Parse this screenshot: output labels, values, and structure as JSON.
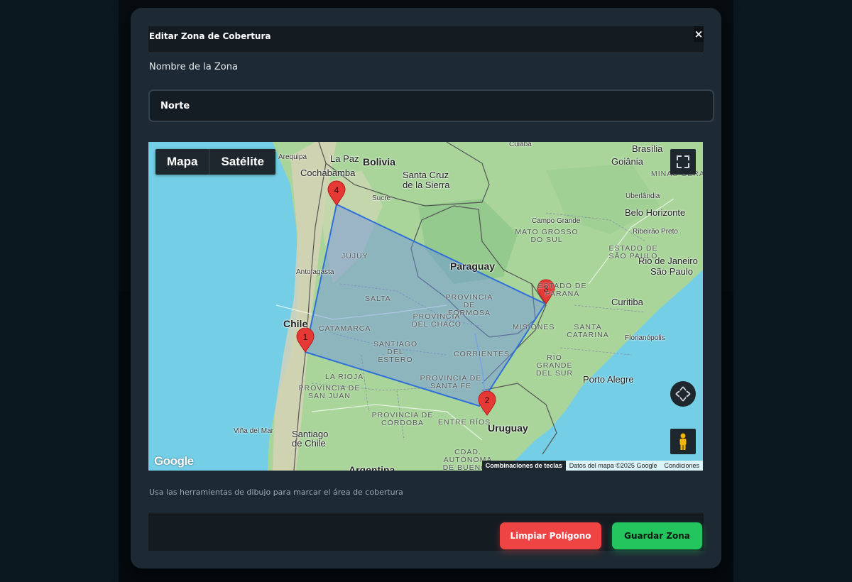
{
  "modal": {
    "title": "Editar Zona de Cobertura",
    "close_label": "×",
    "field_label": "Nombre de la Zona",
    "field_value": "Norte",
    "help_text": "Usa las herramientas de dibujo para marcar el área de cobertura",
    "clear_button": "Limpiar Polígono",
    "save_button": "Guardar Zona"
  },
  "map": {
    "map_type_options": [
      "Mapa",
      "Satélite"
    ],
    "logo": "Google",
    "attribution": {
      "shortcuts": "Combinaciones de teclas",
      "data": "Datos del mapa ©2025 Google",
      "terms": "Condiciones"
    },
    "markers": [
      "1",
      "2",
      "3",
      "4"
    ],
    "countries": [
      "Bolivia",
      "Paraguay",
      "Chile",
      "Uruguay",
      "Argentina"
    ],
    "cities": [
      "Arequipa",
      "La Paz",
      "Cochabamba",
      "Santa Cruz de la Sierra",
      "Sucre",
      "Cuiabá",
      "Brasília",
      "Goiânia",
      "Uberlândia",
      "Belo Horizonte",
      "Campo Grande",
      "Ribeirão Preto",
      "Rio de Janeiro",
      "São Paulo",
      "Antofagasta",
      "Curitiba",
      "Florianópolis",
      "Porto Alegre",
      "Viña del Mar",
      "Santiago de Chile"
    ],
    "regions": [
      "MINAS GERAIS",
      "MATO GROSSO DO SUL",
      "ESTADO DE SÃO PAULO",
      "ESTADO DE PARANÁ",
      "JUJUY",
      "SALTA",
      "PROVINCIA DE FORMOSA",
      "PROVINCIA DEL CHACO",
      "CATAMARCA",
      "SANTIAGO DEL ESTERO",
      "CORRIENTES",
      "MISIONES",
      "SANTA CATARINA",
      "RÍO GRANDE DEL SUR",
      "LA RIOJA",
      "PROVINCIA DE SANTA FE",
      "PROVINCIA DE SAN JUAN",
      "PROVINCIA DE CÓRDOBA",
      "ENTRE RÍOS",
      "CDAD. AUTÓNOMA DE BUENOS"
    ]
  },
  "colors": {
    "modal_bg": "#1e2a33",
    "primary_danger": "#ef4444",
    "primary_success": "#22c55e",
    "polygon": "#3b82f6",
    "marker": "#e53935"
  }
}
